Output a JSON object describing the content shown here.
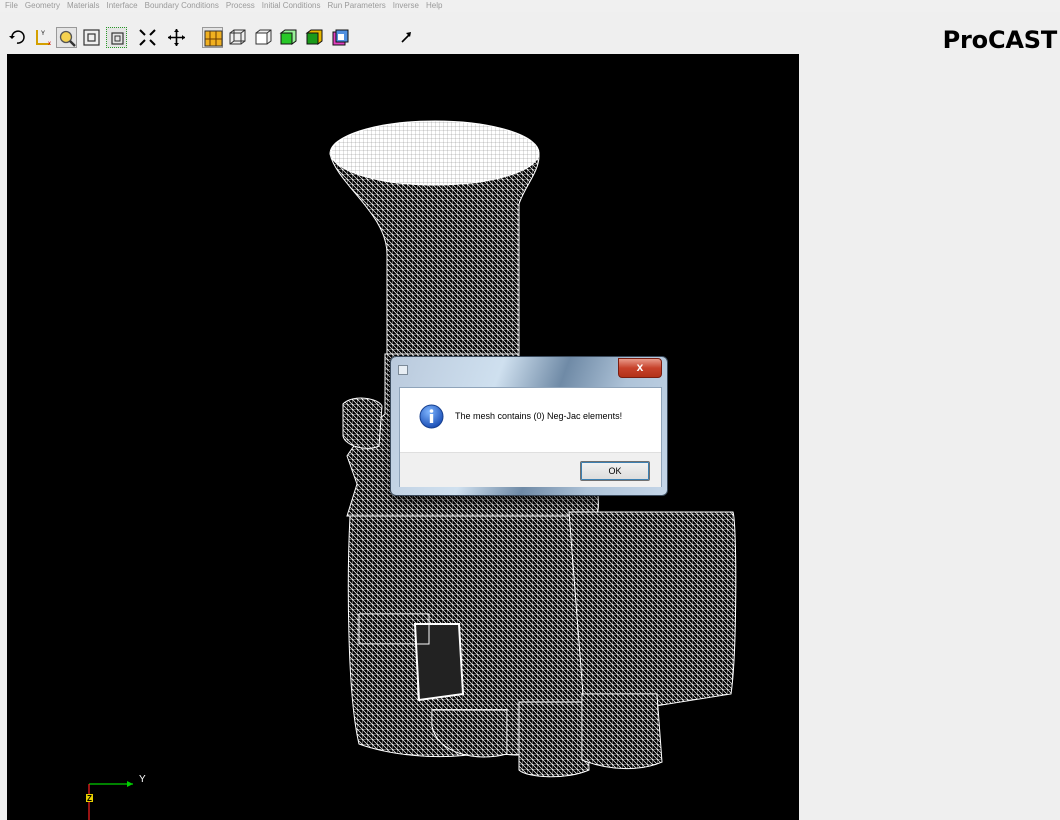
{
  "menu": [
    "File",
    "Geometry",
    "Materials",
    "Interface",
    "Boundary Conditions",
    "Process",
    "Initial Conditions",
    "Run Parameters",
    "Inverse",
    "Help"
  ],
  "brand": "ProCAST",
  "toolbar_icons": [
    "rotate-icon",
    "axes-icon",
    "zoom-icon",
    "zoom-box-icon",
    "fit-view-icon",
    "pan-icon",
    "yellow-mesh-icon",
    "wireframe-icon",
    "hidden-line-icon",
    "green-surface-icon",
    "green-shaded-icon",
    "color-cube-icon",
    "arrow-icon"
  ],
  "axes": {
    "y_label": "Y",
    "z_label": "Z"
  },
  "dialog": {
    "message": "The mesh contains (0) Neg-Jac elements!",
    "ok_label": "OK",
    "close_label": "x"
  },
  "colors": {
    "viewport_bg": "#000000",
    "mesh": "#ffffff",
    "panel_bg": "#efefef"
  }
}
